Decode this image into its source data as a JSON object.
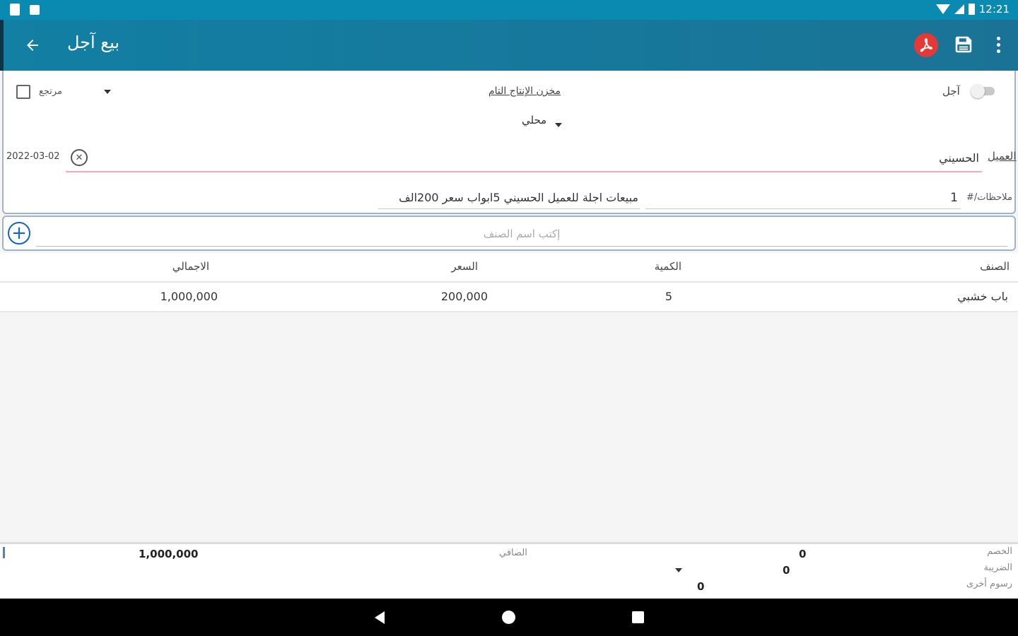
{
  "status_bar": {
    "time": "12:21"
  },
  "app_bar": {
    "title": "بيع آجل",
    "back_icon": "arrow-left-icon",
    "actions": [
      "pdf-icon",
      "save-icon",
      "more-vert-icon"
    ],
    "accent_color": "#127fa3"
  },
  "header": {
    "return_label": "مرتجع",
    "return_checked": false,
    "store_link": "مخزن الإنتاج التام",
    "deferred_label": "آجل",
    "deferred_on": false,
    "type_value": "محلي",
    "date": "2022-03-02",
    "customer_label": "العميل",
    "customer_value": "الحسيني",
    "notes_label": "#/ملاحظات",
    "invoice_no": "1",
    "notes_value": "مبيعات اجلة للعميل الحسيني 5ابواب سعر 200الف"
  },
  "item_search": {
    "placeholder": "إكتب اسم الصنف"
  },
  "table": {
    "columns": {
      "item": "الصنف",
      "qty": "الكمية",
      "price": "السعر",
      "total": "الاجمالي"
    },
    "rows": [
      {
        "item": "باب خشبي",
        "qty": "5",
        "price": "200,000",
        "total": "1,000,000"
      }
    ]
  },
  "footer": {
    "discount_label": "الخصم",
    "discount_value": "0",
    "tax_label": "الضريبة",
    "tax_value": "0",
    "other_fees_label": "رسوم أخرى",
    "other_fees_value": "0",
    "net_label": "الصافي",
    "net_value": "1,000,000"
  }
}
